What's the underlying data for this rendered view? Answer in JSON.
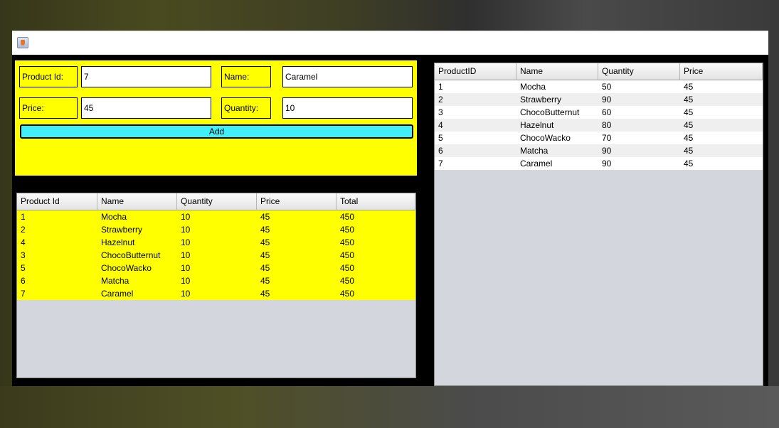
{
  "window": {
    "title": ""
  },
  "form": {
    "product_id_label": "Product Id:",
    "product_id_value": "7",
    "name_label": "Name:",
    "name_value": "Caramel",
    "price_label": "Price:",
    "price_value": "45",
    "quantity_label": "Quantity:",
    "quantity_value": "10",
    "add_label": "Add"
  },
  "order_table": {
    "headers": [
      "Product Id",
      "Name",
      "Quantity",
      "Price",
      "Total"
    ],
    "rows": [
      [
        "1",
        "Mocha",
        "10",
        "45",
        "450"
      ],
      [
        "2",
        "Strawberry",
        "10",
        "45",
        "450"
      ],
      [
        "4",
        "Hazelnut",
        "10",
        "45",
        "450"
      ],
      [
        "3",
        "ChocoButternut",
        "10",
        "45",
        "450"
      ],
      [
        "5",
        "ChocoWacko",
        "10",
        "45",
        "450"
      ],
      [
        "6",
        "Matcha",
        "10",
        "45",
        "450"
      ],
      [
        "7",
        "Caramel",
        "10",
        "45",
        "450"
      ]
    ]
  },
  "product_table": {
    "headers": [
      "ProductID",
      "Name",
      "Quantity",
      "Price"
    ],
    "rows": [
      [
        "1",
        "Mocha",
        "50",
        "45"
      ],
      [
        "2",
        "Strawberry",
        "90",
        "45"
      ],
      [
        "3",
        "ChocoButternut",
        "60",
        "45"
      ],
      [
        "4",
        "Hazelnut",
        "80",
        "45"
      ],
      [
        "5",
        "ChocoWacko",
        "70",
        "45"
      ],
      [
        "6",
        "Matcha",
        "90",
        "45"
      ],
      [
        "7",
        "Caramel",
        "90",
        "45"
      ]
    ]
  },
  "colors": {
    "form_bg": "#ffff00",
    "add_button": "#3ff0f8",
    "window_bg": "#000000",
    "table_empty": "#d4d6dd"
  }
}
